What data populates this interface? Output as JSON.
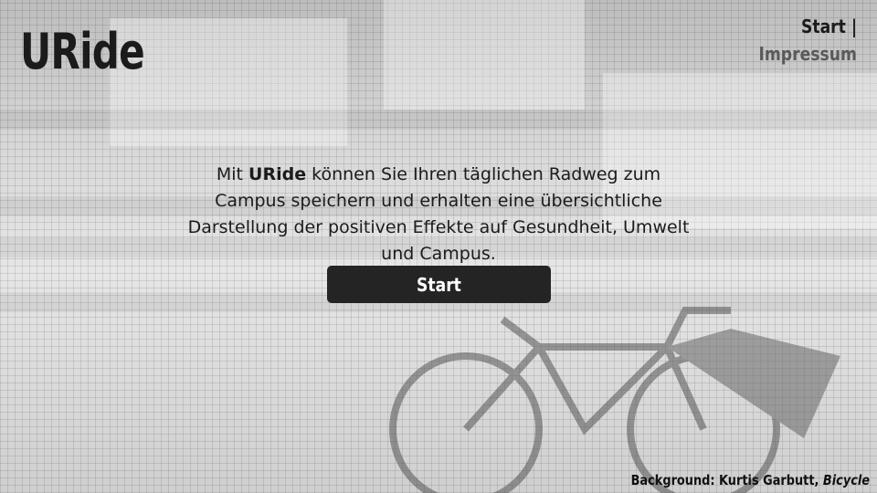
{
  "brand": {
    "logo_text": "URide"
  },
  "nav": {
    "items": [
      {
        "label": "Start",
        "active": true
      },
      {
        "label": "Impressum",
        "active": false
      }
    ],
    "separator": "|"
  },
  "intro": {
    "prefix": "Mit ",
    "brand": "URide",
    "suffix": " können Sie Ihren täglichen Radweg zum Campus speichern und erhalten eine übersichtliche Darstellung der positiven Effekte auf Gesundheit, Umwelt und Campus."
  },
  "start_button": {
    "label": "Start"
  },
  "credit": {
    "prefix": "Background: Kurtis Garbutt, ",
    "work": "Bicycle"
  },
  "colors": {
    "text": "#1b1b1b",
    "muted": "#5a5a5a",
    "button_bg": "#242424",
    "button_text": "#ffffff"
  }
}
